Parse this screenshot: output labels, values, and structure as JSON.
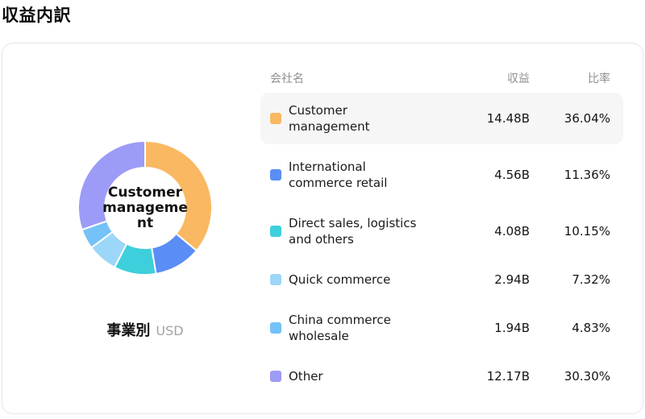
{
  "page": {
    "title": "収益内訳"
  },
  "chart": {
    "center_label": "Customer\nmanageme\nnt",
    "footer_group_label": "事業別",
    "footer_unit": "USD"
  },
  "table": {
    "headers": {
      "name": "会社名",
      "revenue": "収益",
      "ratio": "比率"
    },
    "rows": [
      {
        "name": "Customer\nmanagement",
        "revenue": "14.48B",
        "ratio": "36.04%",
        "color": "#F9B861",
        "highlighted": true
      },
      {
        "name": "International\ncommerce retail",
        "revenue": "4.56B",
        "ratio": "11.36%",
        "color": "#5A8DF5",
        "highlighted": false
      },
      {
        "name": "Direct sales, logistics\nand others",
        "revenue": "4.08B",
        "ratio": "10.15%",
        "color": "#3ECFDC",
        "highlighted": false
      },
      {
        "name": "Quick commerce",
        "revenue": "2.94B",
        "ratio": "7.32%",
        "color": "#9CD6F8",
        "highlighted": false
      },
      {
        "name": "China commerce\nwholesale",
        "revenue": "1.94B",
        "ratio": "4.83%",
        "color": "#74C2F8",
        "highlighted": false
      },
      {
        "name": "Other",
        "revenue": "12.17B",
        "ratio": "30.30%",
        "color": "#9C9BF7",
        "highlighted": false
      }
    ]
  },
  "chart_data": {
    "type": "pie",
    "subtype": "donut",
    "title": "収益内訳",
    "group_label": "事業別",
    "unit": "USD",
    "labels": [
      "Customer management",
      "International commerce retail",
      "Direct sales, logistics and others",
      "Quick commerce",
      "China commerce wholesale",
      "Other"
    ],
    "values_billions": [
      14.48,
      4.56,
      4.08,
      2.94,
      1.94,
      12.17
    ],
    "value_labels": [
      "14.48B",
      "4.56B",
      "4.08B",
      "2.94B",
      "1.94B",
      "12.17B"
    ],
    "percentages": [
      36.04,
      11.36,
      10.15,
      7.32,
      4.83,
      30.3
    ],
    "colors": [
      "#F9B861",
      "#5A8DF5",
      "#3ECFDC",
      "#9CD6F8",
      "#74C2F8",
      "#9C9BF7"
    ],
    "selected_label": "Customer management",
    "start_angle_deg": -90,
    "direction": "clockwise",
    "inner_radius_ratio": 0.6,
    "legend_position": "right"
  }
}
